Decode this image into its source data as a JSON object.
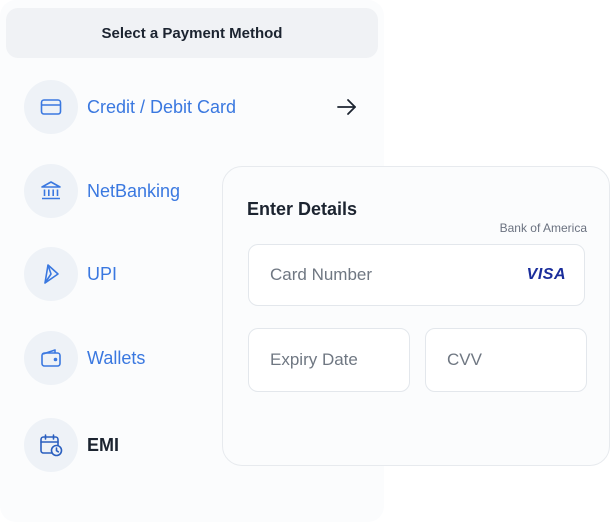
{
  "header": {
    "title": "Select a Payment Method"
  },
  "methods": [
    {
      "label": "Credit / Debit Card",
      "icon": "credit-card-icon"
    },
    {
      "label": "NetBanking",
      "icon": "bank-icon"
    },
    {
      "label": "UPI",
      "icon": "upi-icon"
    },
    {
      "label": "Wallets",
      "icon": "wallet-icon"
    },
    {
      "label": "EMI",
      "icon": "calendar-clock-icon"
    }
  ],
  "details": {
    "title": "Enter Details",
    "bank": "Bank of America",
    "card_number_placeholder": "Card Number",
    "card_brand": "VISA",
    "expiry_placeholder": "Expiry Date",
    "cvv_placeholder": "CVV"
  },
  "colors": {
    "accent": "#3a78e0",
    "icon_bg": "#eef2f7",
    "dark_text": "#1c2430"
  }
}
